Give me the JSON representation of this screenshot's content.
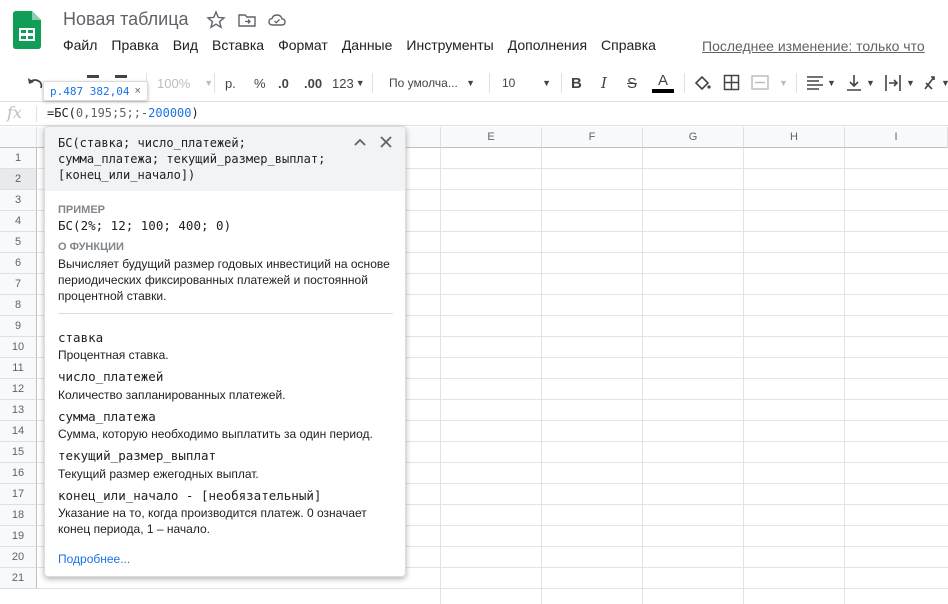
{
  "app": {
    "title": "Новая таблица",
    "last_edit": "Последнее изменение: только что"
  },
  "menu": [
    "Файл",
    "Правка",
    "Вид",
    "Вставка",
    "Формат",
    "Данные",
    "Инструменты",
    "Дополнения",
    "Справка"
  ],
  "toolbar": {
    "zoom": "100%",
    "currency": "р.",
    "percent": "%",
    "dec_decrease": ".0",
    "dec_increase": ".00",
    "more_formats": "123",
    "font": "По умолча...",
    "font_size": "10",
    "bold": "B",
    "italic": "I",
    "strike": "S",
    "text_color": "A"
  },
  "value_tip": {
    "value": "р.487 382,04",
    "close": "×"
  },
  "formula_bar": {
    "fx": "fx",
    "prefix": "=БС(",
    "args": "0,195;5;;-",
    "number": "200000",
    "suffix": ")"
  },
  "columns": [
    "E",
    "F",
    "G",
    "H",
    "I"
  ],
  "rows": [
    "1",
    "2",
    "3",
    "4",
    "5",
    "6",
    "7",
    "8",
    "9",
    "10",
    "11",
    "12",
    "13",
    "14",
    "15",
    "16",
    "17",
    "18",
    "19",
    "20",
    "21"
  ],
  "help": {
    "signature": "БС(ставка; число_платежей;\nсумма_платежа; текущий_размер_выплат;\n[конец_или_начало])",
    "example_label": "ПРИМЕР",
    "example": "БС(2%; 12; 100; 400; 0)",
    "about_label": "О ФУНКЦИИ",
    "about": "Вычисляет будущий размер годовых инвестиций на основе периодических фиксированных платежей и постоянной процентной ставки.",
    "params": [
      {
        "name": "ставка",
        "desc": "Процентная ставка."
      },
      {
        "name": "число_платежей",
        "desc": "Количество запланированных платежей."
      },
      {
        "name": "сумма_платежа",
        "desc": "Сумма, которую необходимо выплатить за один период."
      },
      {
        "name": "текущий_размер_выплат",
        "desc": "Текущий размер ежегодных выплат."
      },
      {
        "name": "конец_или_начало - [необязательный]",
        "desc": "Указание на то, когда производится платеж. 0 означает конец периода, 1 – начало."
      }
    ],
    "more": "Подробнее..."
  },
  "colors": {
    "accent": "#1a73e8",
    "sheets_green": "#0f9d58"
  }
}
